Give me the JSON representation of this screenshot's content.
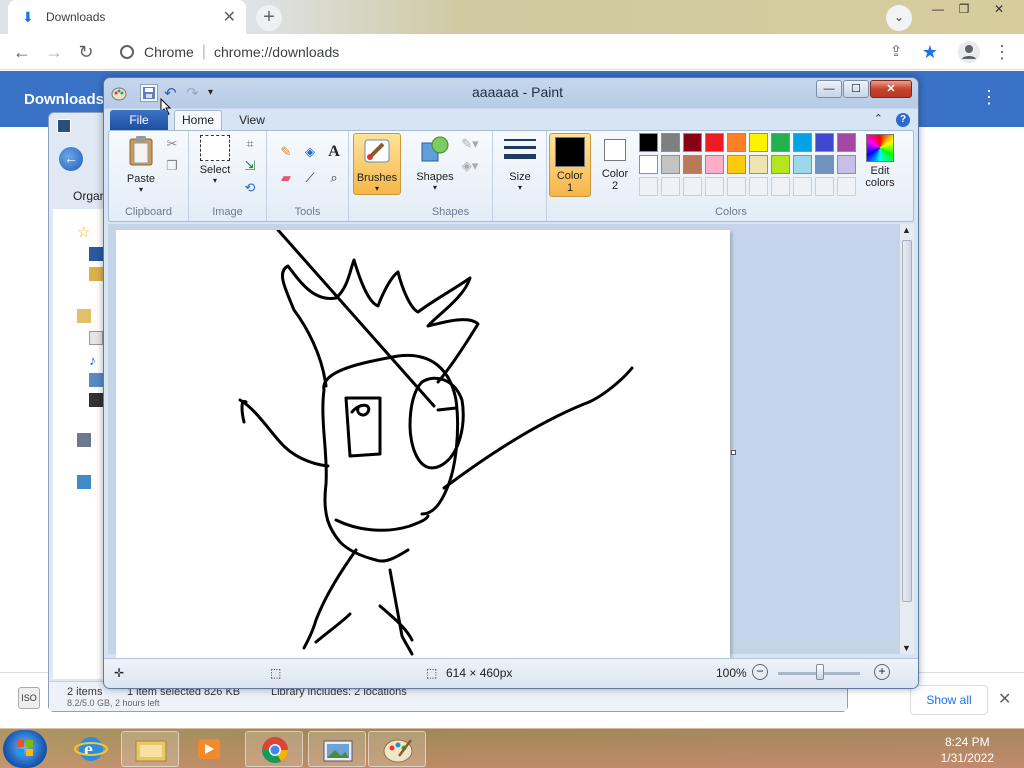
{
  "chrome": {
    "tab_title": "Downloads",
    "omnibox_host": "Chrome",
    "omnibox_url": "chrome://downloads",
    "header_title": "Downloads",
    "show_all": "Show all"
  },
  "explorer": {
    "organize": "Organ",
    "status_items": "2 items",
    "status_selected": "1 item selected  826 KB",
    "status_library": "Library includes: 2 locations",
    "status_extra": "8.2/5.0 GB, 2 hours left"
  },
  "paint": {
    "title": "aaaaaa - Paint",
    "tabs": {
      "file": "File",
      "home": "Home",
      "view": "View"
    },
    "groups": {
      "clipboard": "Clipboard",
      "image": "Image",
      "tools": "Tools",
      "shapes": "Shapes",
      "colors": "Colors"
    },
    "buttons": {
      "paste": "Paste",
      "select": "Select",
      "brushes": "Brushes",
      "shapes": "Shapes",
      "size": "Size",
      "color1": "Color\n1",
      "color1_a": "Color",
      "color1_b": "1",
      "color2_a": "Color",
      "color2_b": "2",
      "edit_colors_a": "Edit",
      "edit_colors_b": "colors"
    },
    "palette_row1": [
      "#000000",
      "#7f7f7f",
      "#880015",
      "#ed1c24",
      "#ff7f27",
      "#fff200",
      "#22b14c",
      "#00a2e8",
      "#3f48cc",
      "#a349a4"
    ],
    "palette_row2": [
      "#ffffff",
      "#c3c3c3",
      "#b97a57",
      "#ffaec9",
      "#ffc90e",
      "#efe4b0",
      "#b5e61d",
      "#99d9ea",
      "#7092be",
      "#c8bfe7"
    ],
    "status_size": "614 × 460px",
    "zoom": "100%"
  },
  "taskbar": {
    "time": "8:24 PM",
    "date": "1/31/2022"
  }
}
